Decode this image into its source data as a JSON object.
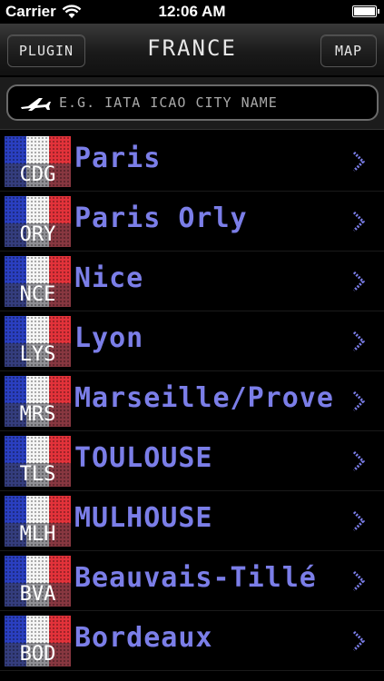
{
  "status": {
    "carrier": "Carrier",
    "time": "12:06 AM"
  },
  "nav": {
    "title": "FRANCE",
    "left_button": "PLUGIN",
    "right_button": "MAP"
  },
  "search": {
    "placeholder": "E.G. IATA ICAO CITY NAME",
    "value": ""
  },
  "colors": {
    "city_text": "#7b7ee8",
    "flag_blue": "#2a3fc0",
    "flag_white": "#f4f4f4",
    "flag_red": "#e2323a"
  },
  "airports": [
    {
      "code": "CDG",
      "city": "Paris"
    },
    {
      "code": "ORY",
      "city": "Paris Orly"
    },
    {
      "code": "NCE",
      "city": "Nice"
    },
    {
      "code": "LYS",
      "city": "Lyon"
    },
    {
      "code": "MRS",
      "city": "Marseille/Prove"
    },
    {
      "code": "TLS",
      "city": "TOULOUSE"
    },
    {
      "code": "MLH",
      "city": "MULHOUSE"
    },
    {
      "code": "BVA",
      "city": "Beauvais-Tillé"
    },
    {
      "code": "BOD",
      "city": "Bordeaux"
    }
  ]
}
